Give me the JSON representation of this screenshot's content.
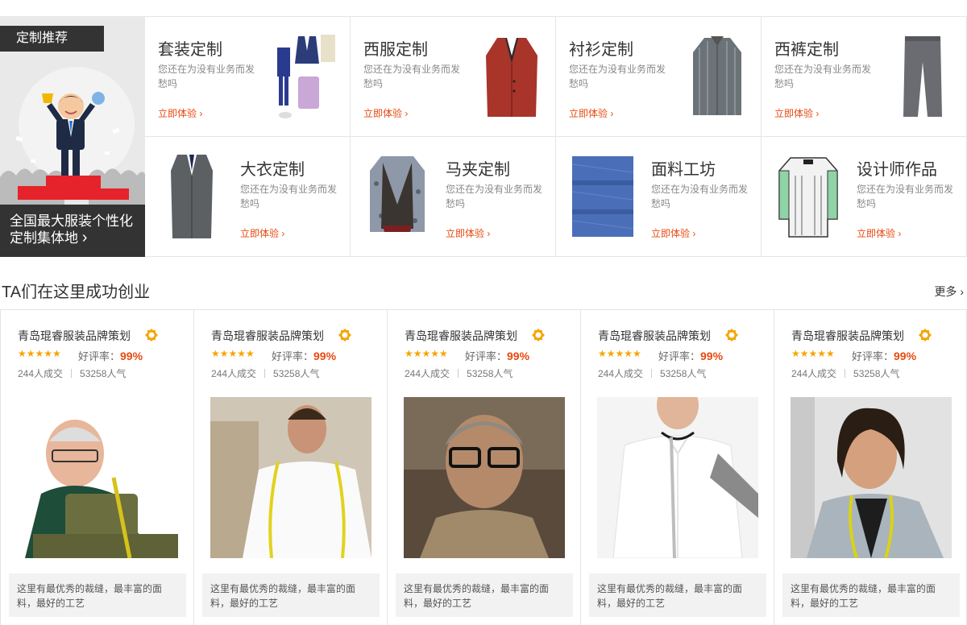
{
  "promo": {
    "tag": "定制推荐",
    "line1": "全国最大服装个性化",
    "line2": "定制集体地 ",
    "arrow": "›"
  },
  "categories": [
    {
      "title": "套装定制",
      "desc": "您还在为没有业务而发愁吗",
      "cta": "立即体验 ›",
      "icon": "suit-set-icon"
    },
    {
      "title": "西服定制",
      "desc": "您还在为没有业务而发愁吗",
      "cta": "立即体验 ›",
      "icon": "blazer-icon"
    },
    {
      "title": "衬衫定制",
      "desc": "您还在为没有业务而发愁吗",
      "cta": "立即体验 ›",
      "icon": "shirt-icon"
    },
    {
      "title": "西裤定制",
      "desc": "您还在为没有业务而发愁吗",
      "cta": "立即体验 ›",
      "icon": "trousers-icon"
    },
    {
      "title": "大衣定制",
      "desc": "您还在为没有业务而发愁吗",
      "cta": "立即体验 ›",
      "icon": "overcoat-icon"
    },
    {
      "title": "马夹定制",
      "desc": "您还在为没有业务而发愁吗",
      "cta": "立即体验 ›",
      "icon": "vest-icon"
    },
    {
      "title": "面料工坊",
      "desc": "您还在为没有业务而发愁吗",
      "cta": "立即体验 ›",
      "icon": "fabric-icon"
    },
    {
      "title": "设计师作品",
      "desc": "您还在为没有业务而发愁吗",
      "cta": "立即体验 ›",
      "icon": "designer-jacket-icon"
    }
  ],
  "section": {
    "title": "TA们在这里成功创业",
    "more": "更多 ›"
  },
  "tailors": [
    {
      "name": "青岛琨睿服装品牌策划",
      "stars": "★★★★★",
      "rate_label": "好评率：",
      "rate": "99%",
      "deals": "244人成交",
      "popularity": "53258人气",
      "quote": "这里有最优秀的裁缝，最丰富的面料，最好的工艺",
      "photo": "tailor-sewing-photo"
    },
    {
      "name": "青岛琨睿服装品牌策划",
      "stars": "★★★★★",
      "rate_label": "好评率：",
      "rate": "99%",
      "deals": "244人成交",
      "popularity": "53258人气",
      "quote": "这里有最优秀的裁缝，最丰富的面料，最好的工艺",
      "photo": "tailor-measuring-tape-photo"
    },
    {
      "name": "青岛琨睿服装品牌策划",
      "stars": "★★★★★",
      "rate_label": "好评率：",
      "rate": "99%",
      "deals": "244人成交",
      "popularity": "53258人气",
      "quote": "这里有最优秀的裁缝，最丰富的面料，最好的工艺",
      "photo": "man-glasses-photo"
    },
    {
      "name": "青岛琨睿服装品牌策划",
      "stars": "★★★★★",
      "rate_label": "好评率：",
      "rate": "99%",
      "deals": "244人成交",
      "popularity": "53258人气",
      "quote": "这里有最优秀的裁缝，最丰富的面料，最好的工艺",
      "photo": "white-shirt-tape-photo"
    },
    {
      "name": "青岛琨睿服装品牌策划",
      "stars": "★★★★★",
      "rate_label": "好评率：",
      "rate": "99%",
      "deals": "244人成交",
      "popularity": "53258人气",
      "quote": "这里有最优秀的裁缝，最丰富的面料，最好的工艺",
      "photo": "young-tailor-photo"
    }
  ],
  "colors": {
    "accent": "#e8490f",
    "star": "#f5a500",
    "dark": "#333333"
  }
}
